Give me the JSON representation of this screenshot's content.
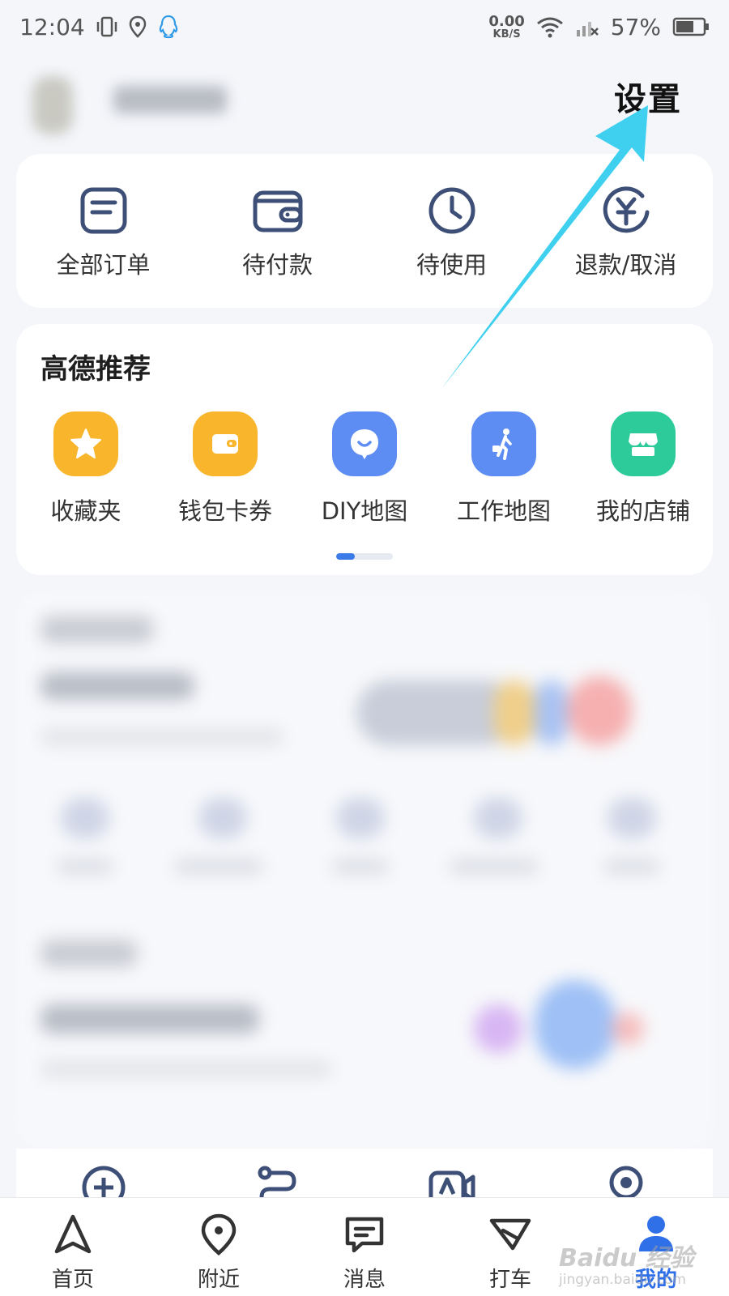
{
  "status_bar": {
    "time": "12:04",
    "net_speed_value": "0.00",
    "net_speed_unit": "KB/S",
    "battery": "57%",
    "icons": [
      "vibrate-icon",
      "location-icon",
      "qq-icon",
      "wifi-icon",
      "signal-icon",
      "battery-icon"
    ]
  },
  "header": {
    "settings_label": "设置"
  },
  "orders": {
    "items": [
      {
        "label": "全部订单",
        "icon": "order-list-icon"
      },
      {
        "label": "待付款",
        "icon": "wallet-icon"
      },
      {
        "label": "待使用",
        "icon": "clock-icon"
      },
      {
        "label": "退款/取消",
        "icon": "refund-icon"
      }
    ]
  },
  "recommend": {
    "title": "高德推荐",
    "items": [
      {
        "label": "收藏夹",
        "icon": "star-icon",
        "color": "#f9b62d"
      },
      {
        "label": "钱包卡券",
        "icon": "wallet-card-icon",
        "color": "#f9b62d"
      },
      {
        "label": "DIY地图",
        "icon": "chat-bubble-icon",
        "color": "#5d8df2"
      },
      {
        "label": "工作地图",
        "icon": "walker-icon",
        "color": "#5d8df2"
      },
      {
        "label": "我的店铺",
        "icon": "store-icon",
        "color": "#2ecb9a"
      }
    ],
    "page_index": 1,
    "page_count": 3
  },
  "bottom_nav": {
    "items": [
      {
        "label": "首页",
        "icon": "navigate-arrow-icon"
      },
      {
        "label": "附近",
        "icon": "map-pin-icon"
      },
      {
        "label": "消息",
        "icon": "message-icon"
      },
      {
        "label": "打车",
        "icon": "taxi-icon"
      },
      {
        "label": "我的",
        "icon": "user-icon",
        "active": true
      }
    ]
  },
  "watermark": {
    "text": "Baidu 经验",
    "sub": "jingyan.baidu.com"
  },
  "colors": {
    "accent": "#2f6fe8",
    "annotation_arrow": "#3fd0f0"
  }
}
